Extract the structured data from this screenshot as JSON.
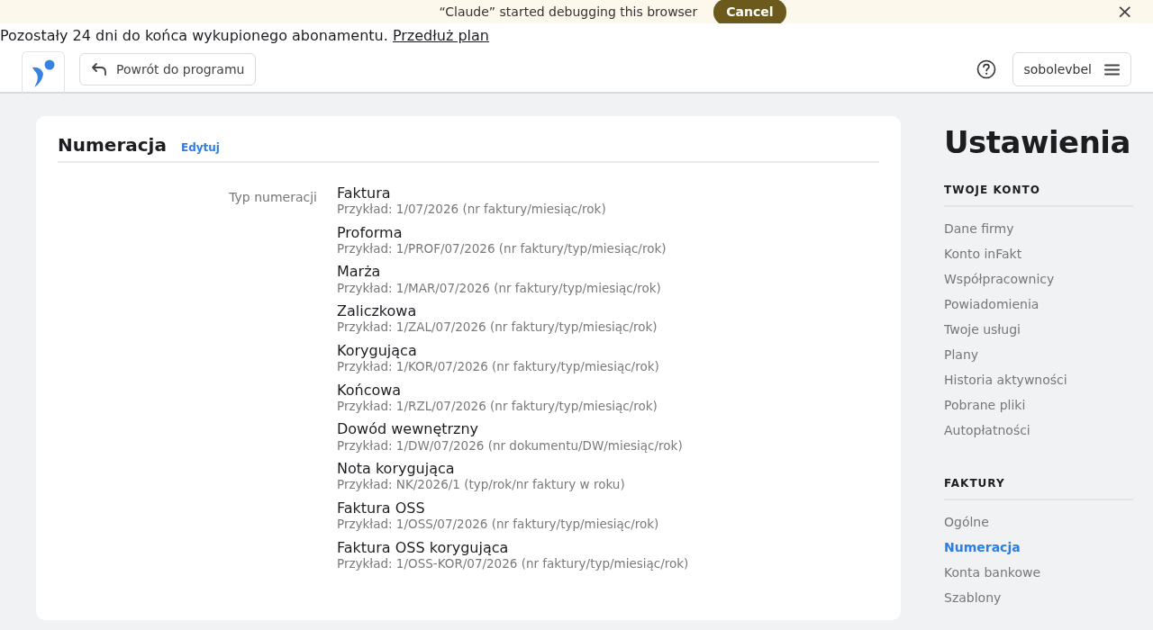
{
  "debug_bar": {
    "message": "“Claude” started debugging this browser",
    "cancel_button": "Cancel",
    "close": "×"
  },
  "subscription_notice": {
    "text": "Pozostały 24 dni do końca wykupionego abonamentu.",
    "link": "Przedłuż plan"
  },
  "header": {
    "back_button": "Powrót do programu",
    "user_menu": "sobolevbel"
  },
  "section": {
    "title": "Numeracja",
    "edit_link": "Edytuj",
    "field_label": "Typ numeracji",
    "types": [
      {
        "name": "Faktura",
        "example": "Przykład: 1/07/2026 (nr faktury/miesiąc/rok)"
      },
      {
        "name": "Proforma",
        "example": "Przykład: 1/PROF/07/2026 (nr faktury/typ/miesiąc/rok)"
      },
      {
        "name": "Marża",
        "example": "Przykład: 1/MAR/07/2026 (nr faktury/typ/miesiąc/rok)"
      },
      {
        "name": "Zaliczkowa",
        "example": "Przykład: 1/ZAL/07/2026 (nr faktury/typ/miesiąc/rok)"
      },
      {
        "name": "Korygująca",
        "example": "Przykład: 1/KOR/07/2026 (nr faktury/typ/miesiąc/rok)"
      },
      {
        "name": "Końcowa",
        "example": "Przykład: 1/RZL/07/2026 (nr faktury/typ/miesiąc/rok)"
      },
      {
        "name": "Dowód wewnętrzny",
        "example": "Przykład: 1/DW/07/2026 (nr dokumentu/DW/miesiąc/rok)"
      },
      {
        "name": "Nota korygująca",
        "example": "Przykład: NK/2026/1 (typ/rok/nr faktury w roku)"
      },
      {
        "name": "Faktura OSS",
        "example": "Przykład: 1/OSS/07/2026 (nr faktury/typ/miesiąc/rok)"
      },
      {
        "name": "Faktura OSS korygująca",
        "example": "Przykład: 1/OSS-KOR/07/2026 (nr faktury/typ/miesiąc/rok)"
      }
    ]
  },
  "sidebar": {
    "title": "Ustawienia",
    "groups": [
      {
        "heading": "TWOJE KONTO",
        "items": [
          {
            "label": "Dane firmy",
            "selected": false
          },
          {
            "label": "Konto inFakt",
            "selected": false
          },
          {
            "label": "Współpracownicy",
            "selected": false
          },
          {
            "label": "Powiadomienia",
            "selected": false
          },
          {
            "label": "Twoje usługi",
            "selected": false
          },
          {
            "label": "Plany",
            "selected": false
          },
          {
            "label": "Historia aktywności",
            "selected": false
          },
          {
            "label": "Pobrane pliki",
            "selected": false
          },
          {
            "label": "Autopłatności",
            "selected": false
          }
        ]
      },
      {
        "heading": "FAKTURY",
        "items": [
          {
            "label": "Ogólne",
            "selected": false
          },
          {
            "label": "Numeracja",
            "selected": true
          },
          {
            "label": "Konta bankowe",
            "selected": false
          },
          {
            "label": "Szablony",
            "selected": false
          }
        ]
      }
    ]
  }
}
